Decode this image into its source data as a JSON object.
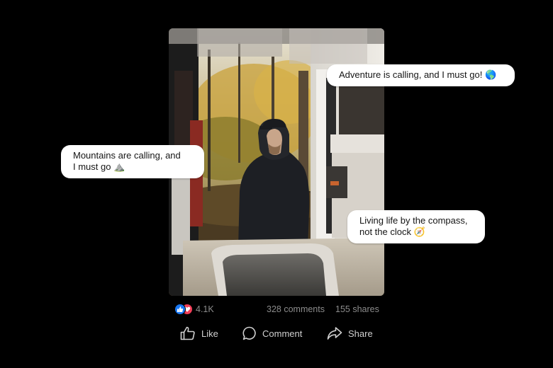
{
  "post": {
    "photo_alt": "man in black hoodie leaning against an open camper van in an autumn forest",
    "captions": [
      {
        "lines": [
          "Adventure is calling, and I must go! 🌎"
        ]
      },
      {
        "lines": [
          "Mountains are calling, and",
          "I must go ⛰️"
        ]
      },
      {
        "lines": [
          "Living life by the compass,",
          "not the clock 🧭"
        ]
      }
    ],
    "stats": {
      "reactions": [
        "like-reaction-icon",
        "love-reaction-icon"
      ],
      "likes": "4.1K",
      "comments": "328 comments",
      "shares": "155 shares"
    },
    "actions": {
      "like": "Like",
      "comment": "Comment",
      "share": "Share"
    }
  },
  "colors": {
    "background": "#000000",
    "like_blue": "#1877f2",
    "love_red": "#f33e58",
    "muted_text": "#8c8c8c"
  }
}
